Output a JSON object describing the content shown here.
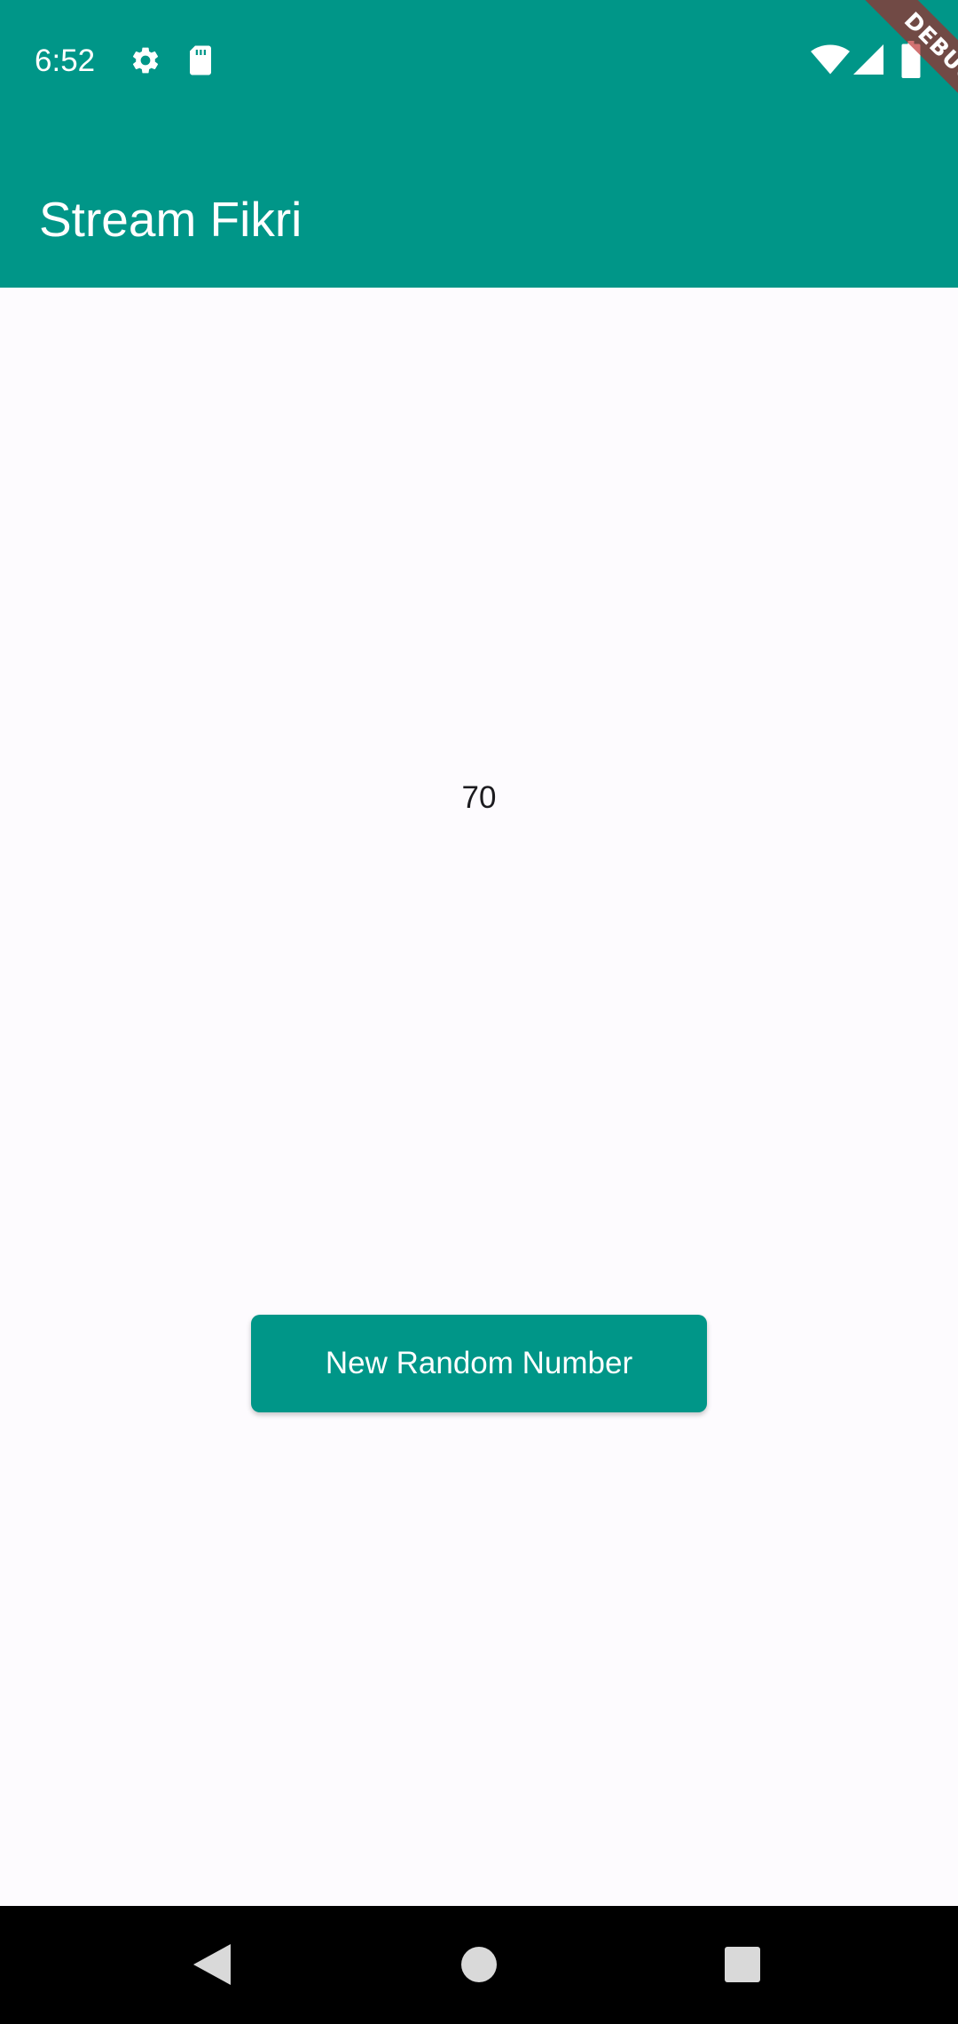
{
  "status_bar": {
    "time": "6:52",
    "icons": [
      "gear-icon",
      "sd-card-icon",
      "wifi-icon",
      "signal-icon",
      "battery-icon"
    ],
    "color": "#009688"
  },
  "app_bar": {
    "title": "Stream Fikri",
    "color": "#009688"
  },
  "debug_banner": {
    "label": "DEBUG"
  },
  "main": {
    "random_number": "70",
    "button_label": "New Random Number"
  },
  "nav_bar": {
    "buttons": [
      "back-icon",
      "home-icon",
      "recents-icon"
    ]
  }
}
